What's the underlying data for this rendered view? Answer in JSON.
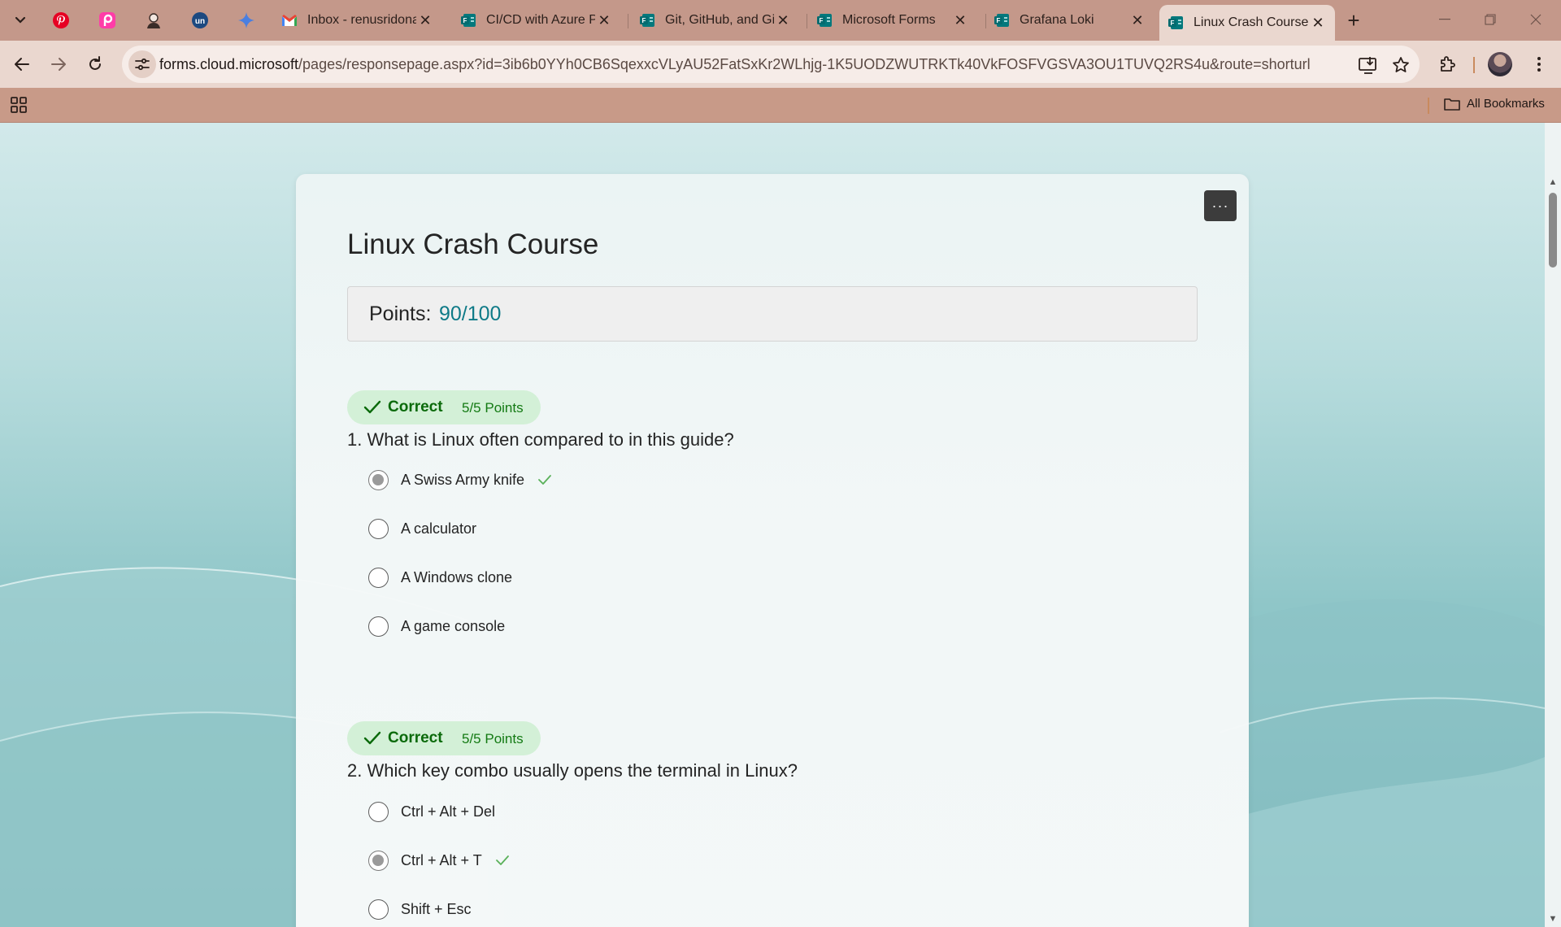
{
  "browser": {
    "tabs": [
      {
        "title": "Inbox - renusridona",
        "icon": "gmail-icon"
      },
      {
        "title": "CI/CD with Azure Pi",
        "icon": "forms-icon"
      },
      {
        "title": "Git, GitHub, and Git",
        "icon": "forms-icon"
      },
      {
        "title": "Microsoft Forms",
        "icon": "forms-icon"
      },
      {
        "title": "Grafana Loki",
        "icon": "forms-icon"
      },
      {
        "title": "Linux Crash Course",
        "icon": "forms-icon",
        "active": true
      }
    ],
    "pinned_tabs": [
      "pinterest-icon",
      "picsart-icon",
      "avatar-icon",
      "unstop-icon",
      "gemini-icon"
    ],
    "url_host": "forms.cloud.microsoft",
    "url_path": "/pages/responsepage.aspx?id=3ib6b0YYh0CB6SqexxcVLyAU52FatSxKr2WLhjg-1K5UODZWUTRKTk40VkFOSFVGSVA3OU1TUVQ2RS4u&route=shorturl",
    "bookmarks_label": "All Bookmarks"
  },
  "form": {
    "title": "Linux Crash Course",
    "points_label": "Points:",
    "points_value": "90/100",
    "more_label": "···",
    "questions": [
      {
        "status": "Correct",
        "points": "5/5 Points",
        "text": "1. What is Linux often compared to in this guide?",
        "options": [
          {
            "label": "A Swiss Army knife",
            "selected": true,
            "correct": true
          },
          {
            "label": "A calculator",
            "selected": false
          },
          {
            "label": "A Windows clone",
            "selected": false
          },
          {
            "label": "A game console",
            "selected": false
          }
        ]
      },
      {
        "status": "Correct",
        "points": "5/5 Points",
        "text": "2. Which key combo usually opens the terminal in Linux?",
        "options": [
          {
            "label": "Ctrl + Alt + Del",
            "selected": false
          },
          {
            "label": "Ctrl + Alt + T",
            "selected": true,
            "correct": true
          },
          {
            "label": "Shift + Esc",
            "selected": false
          }
        ]
      }
    ]
  },
  "colors": {
    "chrome_tabbar": "#c4988a",
    "chrome_toolbar": "#ead7cf",
    "badge_bg": "#d3f0d7",
    "badge_text": "#0b6a0b",
    "points_value": "#0e7a87"
  }
}
